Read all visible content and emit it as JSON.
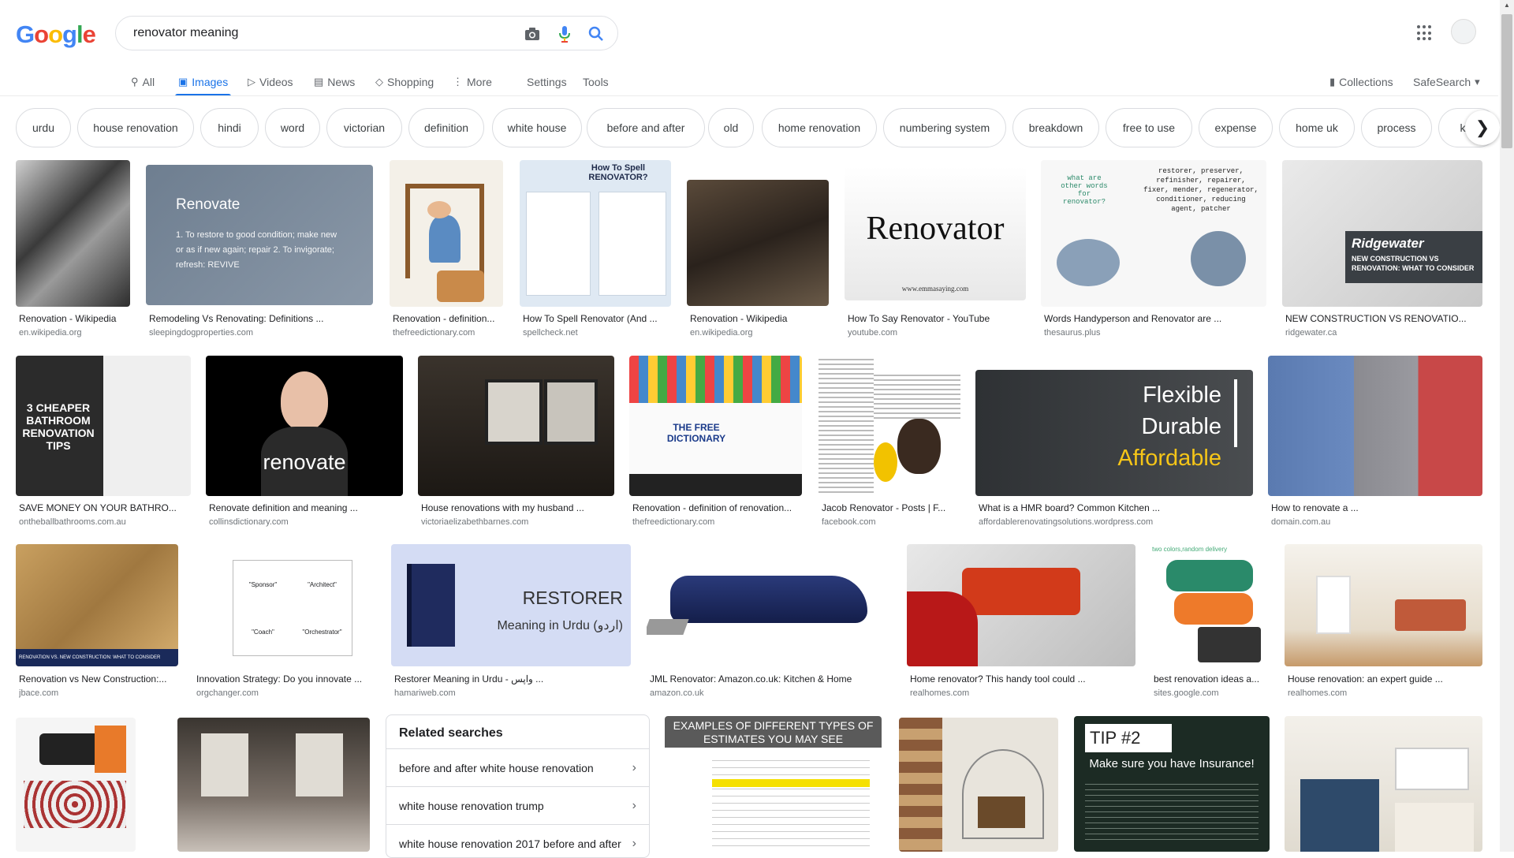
{
  "logo": {
    "letters": [
      "G",
      "o",
      "o",
      "g",
      "l",
      "e"
    ],
    "colors": [
      "#4285F4",
      "#EA4335",
      "#FBBC05",
      "#4285F4",
      "#34A853",
      "#EA4335"
    ]
  },
  "search": {
    "query": "renovator meaning",
    "camera_icon": "camera-icon",
    "mic_icon": "mic-icon",
    "search_icon": "search-icon"
  },
  "tabs": {
    "all": "All",
    "images": "Images",
    "videos": "Videos",
    "news": "News",
    "shopping": "Shopping",
    "more": "More",
    "settings": "Settings",
    "tools": "Tools",
    "collections": "Collections",
    "safesearch": "SafeSearch"
  },
  "chips": [
    "urdu",
    "house renovation",
    "hindi",
    "word",
    "victorian",
    "definition",
    "white house",
    "before and after",
    "old",
    "home renovation",
    "numbering system",
    "breakdown",
    "free to use",
    "expense",
    "home uk",
    "process",
    "kitc"
  ],
  "images": [
    {
      "title": "Renovation - Wikipedia",
      "source": "en.wikipedia.org"
    },
    {
      "title": "Remodeling Vs Renovating: Definitions ...",
      "source": "sleepingdogproperties.com",
      "text": "Renovate",
      "subtext": "1. To restore to good condition; make new or as if new again; repair  2. To invigorate; refresh: REVIVE"
    },
    {
      "title": "Renovation - definition...",
      "source": "thefreedictionary.com"
    },
    {
      "title": "How To Spell Renovator (And ...",
      "source": "spellcheck.net",
      "text": "How To Spell RENOVATOR?"
    },
    {
      "title": "Renovation - Wikipedia",
      "source": "en.wikipedia.org"
    },
    {
      "title": "How To Say Renovator - YouTube",
      "source": "youtube.com",
      "text": "Renovator",
      "subtext": "www.emmasaying.com"
    },
    {
      "title": "Words Handyperson and Renovator are ...",
      "source": "thesaurus.plus",
      "text": "restorer, preserver, refinisher, repairer, fixer, mender, regenerator, conditioner, reducing agent, patcher",
      "subtext": "what are other words for renovator?"
    },
    {
      "title": "NEW CONSTRUCTION VS RENOVATIO...",
      "source": "ridgewater.ca",
      "text": "Ridgewater",
      "subtext": "NEW CONSTRUCTION VS RENOVATION: WHAT TO CONSIDER"
    },
    {
      "title": "SAVE MONEY ON YOUR BATHRO...",
      "source": "ontheballbathrooms.com.au",
      "text": "3 CHEAPER BATHROOM RENOVATION TIPS"
    },
    {
      "title": "Renovate definition and meaning ...",
      "source": "collinsdictionary.com",
      "text": "renovate"
    },
    {
      "title": "House renovations with my husband ...",
      "source": "victoriaelizabethbarnes.com"
    },
    {
      "title": "Renovation - definition of renovation...",
      "source": "thefreedictionary.com",
      "text": "THE FREE DICTIONARY"
    },
    {
      "title": "Jacob Renovator - Posts | F...",
      "source": "facebook.com"
    },
    {
      "title": "What is a HMR board? Common Kitchen ...",
      "source": "affordablerenovatingsolutions.wordpress.com",
      "lines": [
        "Flexible",
        "Durable",
        "Affordable"
      ]
    },
    {
      "title": "How to renovate a ...",
      "source": "domain.com.au"
    },
    {
      "title": "Renovation vs New Construction:...",
      "source": "jbace.com",
      "text": "RENOVATION VS. NEW CONSTRUCTION: WHAT TO CONSIDER"
    },
    {
      "title": "Innovation Strategy: Do you innovate ...",
      "source": "orgchanger.com",
      "lines": [
        "\"Sponsor\"",
        "\"Architect\"",
        "\"Coach\"",
        "\"Orchestrator\""
      ]
    },
    {
      "title": "Restorer Meaning in Urdu - واپس ...",
      "source": "hamariweb.com",
      "text": "RESTORER",
      "subtext": "Meaning in Urdu (اردو)"
    },
    {
      "title": "JML Renovator: Amazon.co.uk: Kitchen & Home",
      "source": "amazon.co.uk"
    },
    {
      "title": "Home renovator? This handy tool could ...",
      "source": "realhomes.com"
    },
    {
      "title": "best renovation ideas a...",
      "source": "sites.google.com",
      "subtext": "two colors,random delivery"
    },
    {
      "title": "House renovation: an expert guide ...",
      "source": "realhomes.com"
    },
    {
      "title": "",
      "source": ""
    },
    {
      "title": "",
      "source": ""
    },
    {
      "title": "",
      "source": "",
      "text": "EXAMPLES OF DIFFERENT TYPES OF ESTIMATES YOU MAY SEE"
    },
    {
      "title": "",
      "source": ""
    },
    {
      "title": "",
      "source": "",
      "text": "TIP #2",
      "subtext": "Make sure you have Insurance!"
    },
    {
      "title": "",
      "source": ""
    }
  ],
  "related": {
    "heading": "Related searches",
    "items": [
      "before and after white house renovation",
      "white house renovation trump",
      "white house renovation 2017 before and after"
    ]
  },
  "colors": {
    "accent": "#1a73e8"
  }
}
